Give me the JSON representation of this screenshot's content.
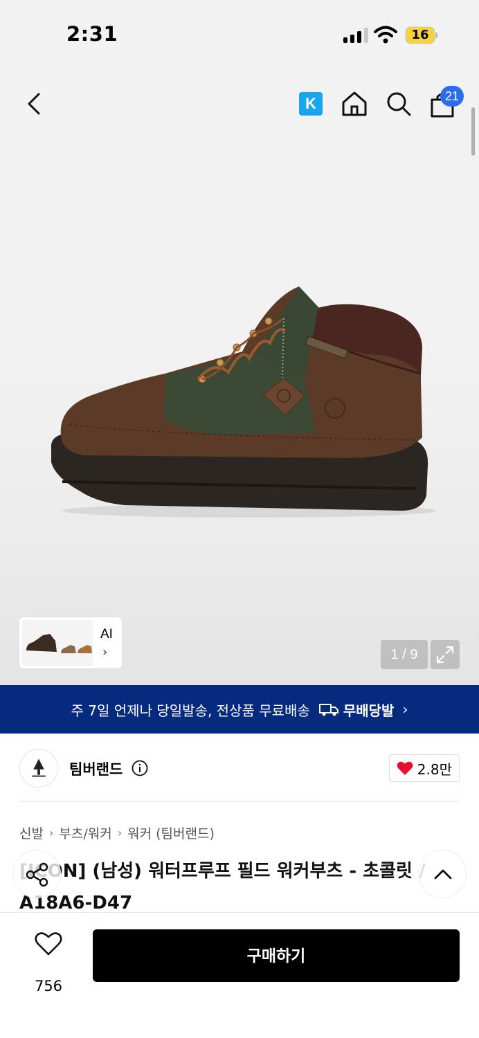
{
  "status_bar": {
    "time": "2:31",
    "battery": "16"
  },
  "header": {
    "k_badge": "K",
    "cart_count": "21"
  },
  "gallery": {
    "ai_label": "AI",
    "ai_chevron": "›",
    "counter": "1 / 9"
  },
  "banner": {
    "text": "주 7일 언제나 당일발송, 전상품 무료배송",
    "brand": "무배당발",
    "chevron": "›"
  },
  "brand": {
    "name": "팀버랜드",
    "likes": "2.8만"
  },
  "breadcrumb": [
    "신발",
    "부츠/워커",
    "워커 (팀버랜드)"
  ],
  "product": {
    "title": "[ICON] (남성) 워터프루프 필드 워커부츠 - 초콜릿 / A18A6-D47"
  },
  "bottom_bar": {
    "wish_count": "756",
    "buy_label": "구매하기"
  },
  "colors": {
    "banner_bg": "#062a7e",
    "cart_badge": "#2c6cf0",
    "k_badge": "#1aa5f0",
    "like_heart": "#e8102c"
  }
}
